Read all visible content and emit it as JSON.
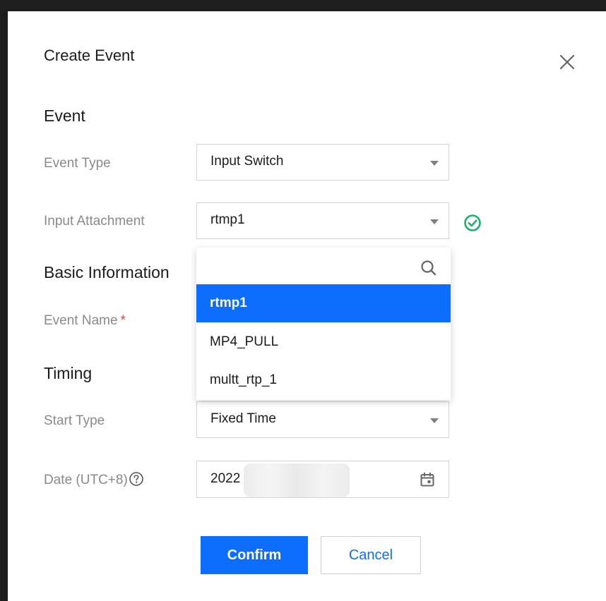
{
  "dialog": {
    "title": "Create Event",
    "close_icon": "close-icon"
  },
  "event_section": {
    "heading": "Event",
    "event_type": {
      "label": "Event Type",
      "value": "Input Switch"
    },
    "input_attachment": {
      "label": "Input Attachment",
      "value": "rtmp1",
      "status_icon": "check-circle-icon",
      "status_color": "#19b36b"
    }
  },
  "basic_section": {
    "heading": "Basic Information",
    "event_name": {
      "label": "Event Name",
      "required_mark": "*"
    }
  },
  "timing_section": {
    "heading": "Timing",
    "start_type": {
      "label": "Start Type",
      "value": "Fixed Time"
    },
    "date": {
      "label": "Date (UTC+8)",
      "value": "2022",
      "help_icon": "help-circle-icon",
      "calendar_icon": "calendar-icon"
    }
  },
  "dropdown": {
    "search_placeholder": "",
    "search_icon": "search-icon",
    "options": [
      {
        "label": "rtmp1",
        "selected": true
      },
      {
        "label": "MP4_PULL",
        "selected": false
      },
      {
        "label": "multt_rtp_1",
        "selected": false
      }
    ]
  },
  "buttons": {
    "confirm": "Confirm",
    "cancel": "Cancel"
  },
  "colors": {
    "primary": "#0d6efd",
    "success": "#19b36b",
    "required": "#e54545"
  }
}
